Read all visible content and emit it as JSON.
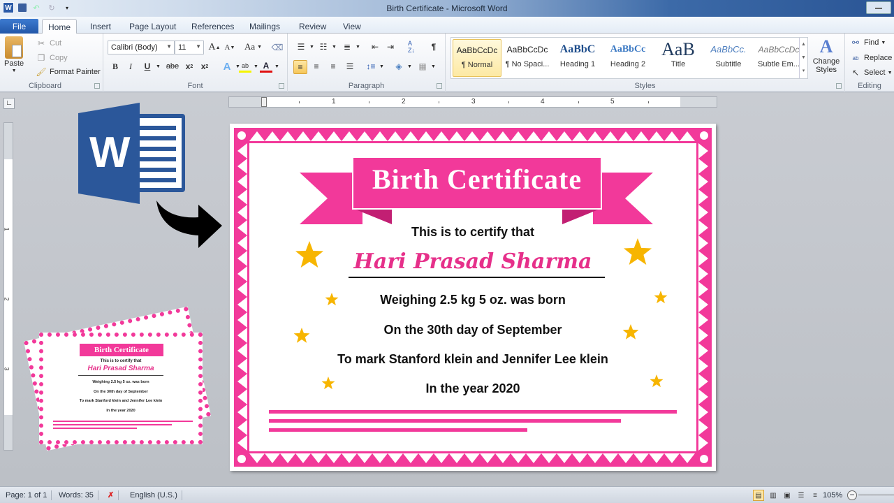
{
  "window": {
    "title": "Birth Certificate - Microsoft Word",
    "quick_access": [
      "word-logo-icon",
      "save-icon",
      "undo-icon",
      "redo-icon",
      "customize-qat-icon"
    ]
  },
  "tabs": [
    {
      "label": "File"
    },
    {
      "label": "Home"
    },
    {
      "label": "Insert"
    },
    {
      "label": "Page Layout"
    },
    {
      "label": "References"
    },
    {
      "label": "Mailings"
    },
    {
      "label": "Review"
    },
    {
      "label": "View"
    }
  ],
  "ribbon": {
    "clipboard": {
      "label": "Clipboard",
      "paste": "Paste",
      "cut": "Cut",
      "copy": "Copy",
      "format_painter": "Format Painter"
    },
    "font": {
      "label": "Font",
      "font_name": "Calibri (Body)",
      "font_size": "11",
      "change_case": "Aa"
    },
    "paragraph": {
      "label": "Paragraph"
    },
    "styles": {
      "label": "Styles",
      "items": [
        {
          "sample": "AaBbCcDc",
          "name": "¶ Normal",
          "selected": true
        },
        {
          "sample": "AaBbCcDc",
          "name": "¶ No Spaci..."
        },
        {
          "sample": "AaBbC",
          "name": "Heading 1"
        },
        {
          "sample": "AaBbCc",
          "name": "Heading 2"
        },
        {
          "sample": "AaB",
          "name": "Title"
        },
        {
          "sample": "AaBbCc.",
          "name": "Subtitle"
        },
        {
          "sample": "AaBbCcDc",
          "name": "Subtle Em..."
        }
      ],
      "change_styles": "Change Styles"
    },
    "editing": {
      "label": "Editing",
      "find": "Find",
      "replace": "Replace",
      "select": "Select"
    }
  },
  "ruler": {
    "labels": [
      "1",
      "2",
      "3",
      "4",
      "5"
    ],
    "vlabels": [
      "1",
      "2",
      "3"
    ]
  },
  "word_logo": {
    "letter": "W"
  },
  "certificate": {
    "title": "Birth Certificate",
    "certify": "This is to certify that",
    "name": "Hari Prasad Sharma",
    "lines": [
      "Weighing 2.5 kg 5 oz. was born",
      "On the 30th day of September",
      "To mark Stanford klein and Jennifer Lee klein",
      "In the year 2020"
    ],
    "colors": {
      "pink": "#f2399a",
      "dark_pink": "#c21f73",
      "star": "#f7b500"
    }
  },
  "status": {
    "page": "Page: 1 of 1",
    "words": "Words: 35",
    "language": "English (U.S.)",
    "zoom": "105%"
  }
}
